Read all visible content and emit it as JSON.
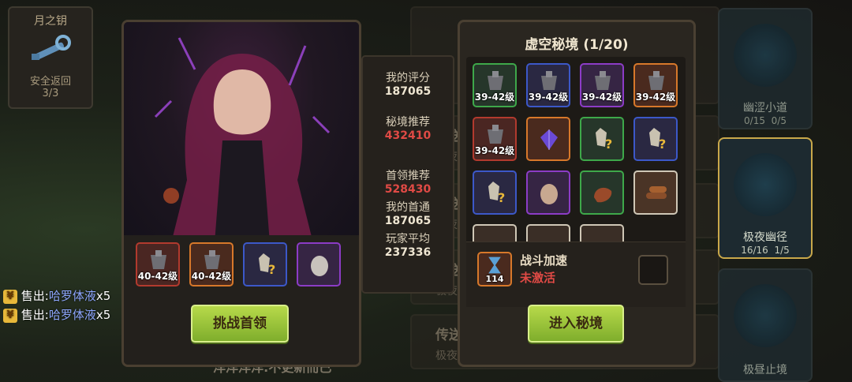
{
  "colors": {
    "accent_green": "#9cc83c",
    "value_red": "#e04a45",
    "panel": "#2a2620"
  },
  "key_widget": {
    "title": "月之钥",
    "label": "安全返回",
    "count": "3/3"
  },
  "background": {
    "rows": [
      {
        "title": "传送",
        "sub": "极夜"
      },
      {
        "title": "传送",
        "sub": "极夜"
      },
      {
        "title": "传送",
        "sub": "极夜"
      },
      {
        "title": "传送",
        "sub": "极夜"
      }
    ],
    "chat_text": "洋洋洋洋:不更新而已"
  },
  "locations": [
    {
      "name": "幽涩小道",
      "count_a": "0/15",
      "count_b": "0/5"
    },
    {
      "name": "极夜幽径",
      "count_a": "16/16",
      "count_b": "1/5"
    },
    {
      "name": "极昼止境",
      "count_a": "",
      "count_b": ""
    }
  ],
  "hero": {
    "rewards": [
      {
        "icon": "armor-icon",
        "level": "40-42级",
        "rarity": "red"
      },
      {
        "icon": "armor-icon",
        "level": "40-42级",
        "rarity": "orange"
      },
      {
        "icon": "crystal-unknown-icon",
        "level": "",
        "rarity": "blue"
      },
      {
        "icon": "egg-icon",
        "level": "",
        "rarity": "purple"
      }
    ],
    "challenge_button": "挑战首领"
  },
  "stats": {
    "my_score_label": "我的评分",
    "my_score": "187065",
    "recommend_label": "秘境推荐",
    "recommend": "432410",
    "boss_label": "首领推荐",
    "boss": "528430",
    "first_clear_label": "我的首通",
    "first_clear": "187065",
    "avg_label": "玩家平均",
    "avg": "237336"
  },
  "dungeon": {
    "title": "虚空秘境 (1/20)",
    "grid": [
      {
        "icon": "armor-icon",
        "level": "39-42级",
        "rarity": "green"
      },
      {
        "icon": "armor-icon",
        "level": "39-42级",
        "rarity": "blue"
      },
      {
        "icon": "armor-icon",
        "level": "39-42级",
        "rarity": "purple"
      },
      {
        "icon": "armor-icon",
        "level": "39-42级",
        "rarity": "orange"
      },
      {
        "icon": "armor-icon",
        "level": "39-42级",
        "rarity": "red"
      },
      {
        "icon": "purple-crystal-icon",
        "level": "",
        "rarity": "orange"
      },
      {
        "icon": "crystal-unknown-icon",
        "level": "",
        "rarity": "green"
      },
      {
        "icon": "crystal-unknown-icon",
        "level": "",
        "rarity": "blue"
      },
      {
        "icon": "crystal-unknown-icon",
        "level": "",
        "rarity": "blue"
      },
      {
        "icon": "egg-icon",
        "level": "",
        "rarity": "purple"
      },
      {
        "icon": "meat-icon",
        "level": "",
        "rarity": "green"
      },
      {
        "icon": "wood-icon",
        "level": "",
        "rarity": "white"
      }
    ],
    "boost_title": "战斗加速",
    "boost_status": "未激活",
    "boost_count": "114",
    "enter_button": "进入秘境"
  },
  "sold": [
    {
      "prefix": "售出:",
      "item": "哈罗体液",
      "qty": "x5"
    },
    {
      "prefix": "售出:",
      "item": "哈罗体液",
      "qty": "x5"
    }
  ]
}
